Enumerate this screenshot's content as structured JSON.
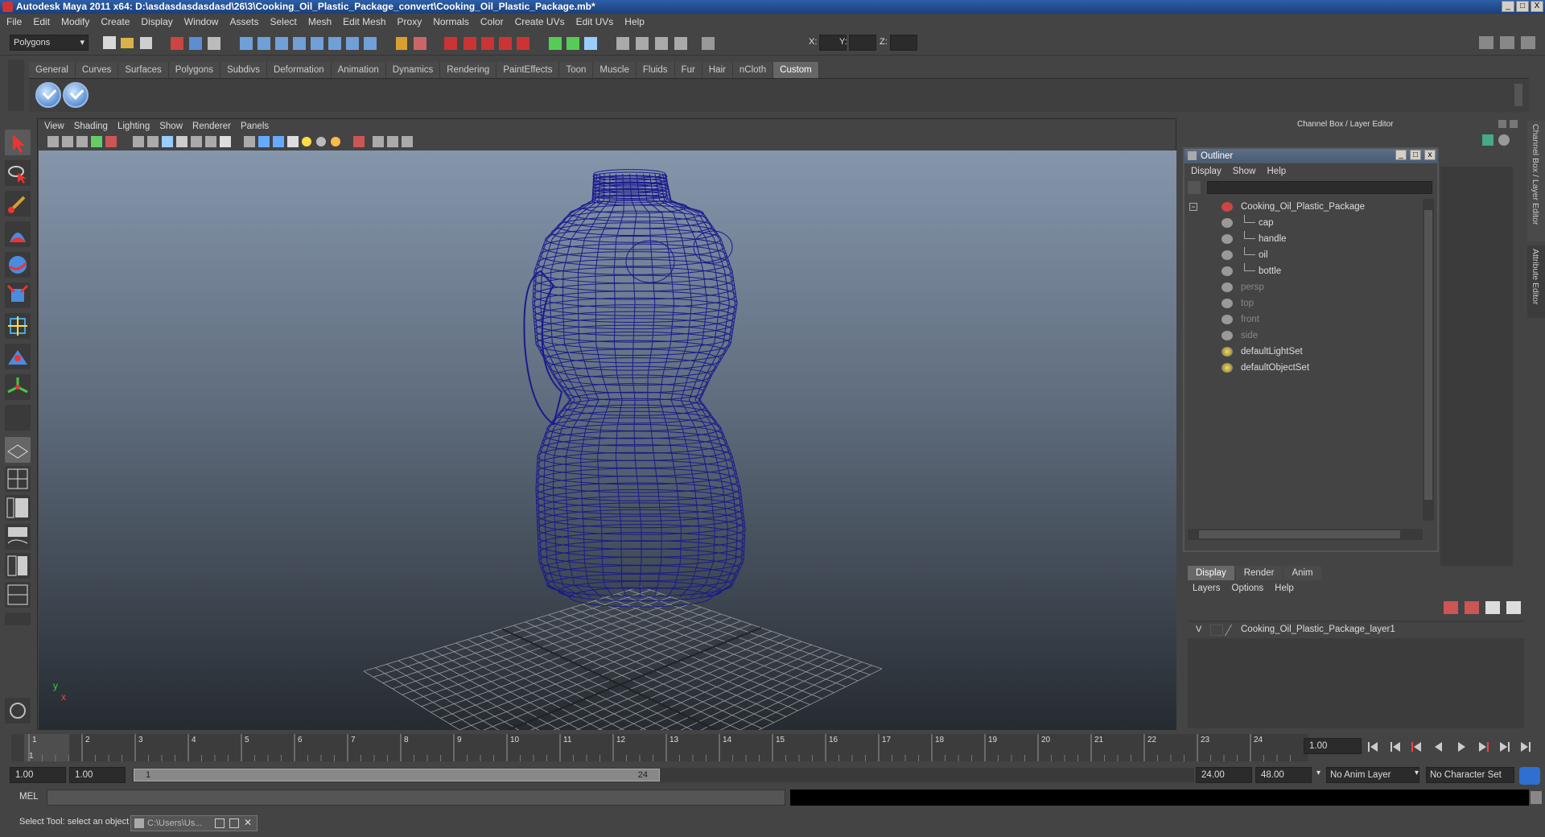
{
  "window": {
    "title": "Autodesk Maya 2011 x64: D:\\asdasdasdasdasd\\26\\3\\Cooking_Oil_Plastic_Package_convert\\Cooking_Oil_Plastic_Package.mb*",
    "buttons": [
      "_",
      "□",
      "X"
    ]
  },
  "menubar": [
    "File",
    "Edit",
    "Modify",
    "Create",
    "Display",
    "Window",
    "Assets",
    "Select",
    "Mesh",
    "Edit Mesh",
    "Proxy",
    "Normals",
    "Color",
    "Create UVs",
    "Edit UVs",
    "Help"
  ],
  "statusline": {
    "mode": "Polygons",
    "x_label": "X:",
    "y_label": "Y:",
    "z_label": "Z:"
  },
  "shelf": {
    "tabs": [
      "General",
      "Curves",
      "Surfaces",
      "Polygons",
      "Subdivs",
      "Deformation",
      "Animation",
      "Dynamics",
      "Rendering",
      "PaintEffects",
      "Toon",
      "Muscle",
      "Fluids",
      "Fur",
      "Hair",
      "nCloth",
      "Custom"
    ],
    "active_tab": "Custom"
  },
  "viewport": {
    "menu": [
      "View",
      "Shading",
      "Lighting",
      "Show",
      "Renderer",
      "Panels"
    ],
    "axis_x": "x",
    "axis_y": "y",
    "wire_color": "#1a1a8c",
    "grid_color": "#9a9a9a"
  },
  "channelbox": {
    "title": "Channel Box / Layer Editor",
    "side_tabs": [
      "Channel Box / Layer Editor",
      "Attribute Editor"
    ]
  },
  "outliner": {
    "title": "Outliner",
    "menu": [
      "Display",
      "Show",
      "Help"
    ],
    "items": [
      {
        "label": "Cooking_Oil_Plastic_Package",
        "depth": 0,
        "dim": false
      },
      {
        "label": "cap",
        "depth": 1,
        "dim": false
      },
      {
        "label": "handle",
        "depth": 1,
        "dim": false
      },
      {
        "label": "oil",
        "depth": 1,
        "dim": false
      },
      {
        "label": "bottle",
        "depth": 1,
        "dim": false
      },
      {
        "label": "persp",
        "depth": 0,
        "dim": true
      },
      {
        "label": "top",
        "depth": 0,
        "dim": true
      },
      {
        "label": "front",
        "depth": 0,
        "dim": true
      },
      {
        "label": "side",
        "depth": 0,
        "dim": true
      },
      {
        "label": "defaultLightSet",
        "depth": 0,
        "dim": false
      },
      {
        "label": "defaultObjectSet",
        "depth": 0,
        "dim": false
      }
    ]
  },
  "layers": {
    "tabs": [
      "Display",
      "Render",
      "Anim"
    ],
    "active_tab": "Display",
    "menu": [
      "Layers",
      "Options",
      "Help"
    ],
    "layer_visibility": "V",
    "layer_name": "Cooking_Oil_Plastic_Package_layer1"
  },
  "timeline": {
    "ticks": [
      "1",
      "2",
      "3",
      "4",
      "5",
      "6",
      "7",
      "8",
      "9",
      "10",
      "11",
      "12",
      "13",
      "14",
      "15",
      "16",
      "17",
      "18",
      "19",
      "20",
      "21",
      "22",
      "23",
      "24"
    ],
    "current_frame": "1.00",
    "current_marker": "1"
  },
  "range": {
    "start": "1.00",
    "playback_start": "1.00",
    "slider_start": "1",
    "slider_end": "24",
    "playback_end": "24.00",
    "end": "48.00",
    "anim_layer": "No Anim Layer",
    "character_set": "No Character Set"
  },
  "command": {
    "label": "MEL"
  },
  "helpline": {
    "text": "Select Tool: select an object",
    "taskbar_item": "C:\\Users\\Us..."
  }
}
